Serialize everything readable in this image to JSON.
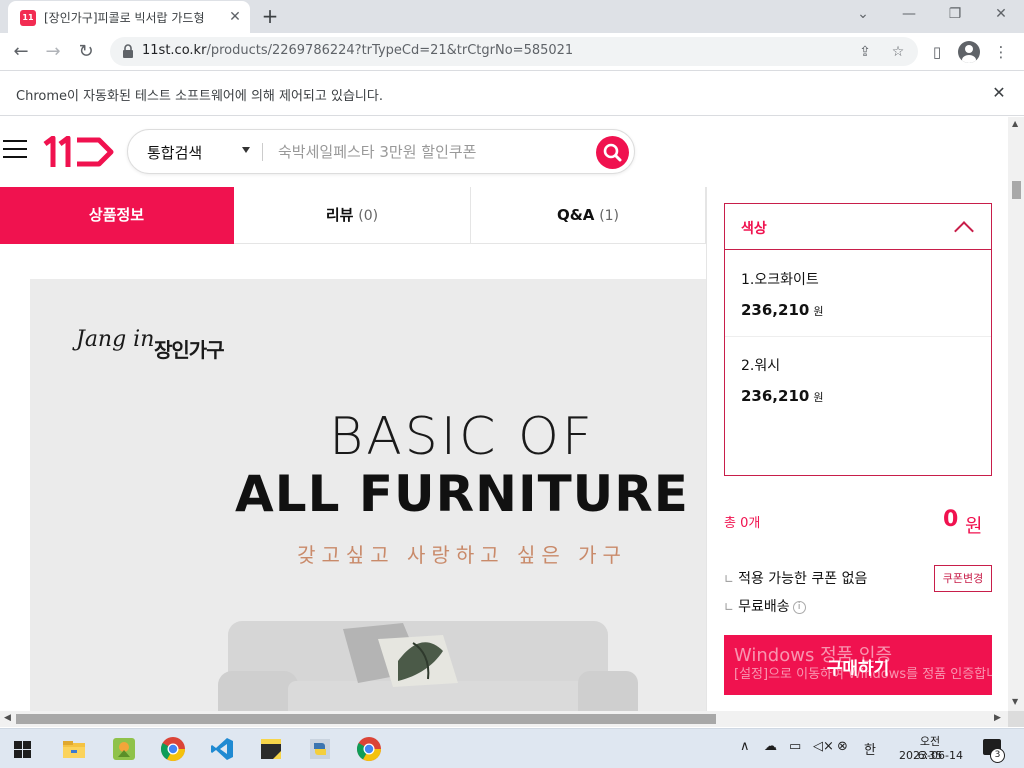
{
  "browser": {
    "tab_title": "[장인가구]피콜로 빅서랍 가드형",
    "tab_favicon_text": "11",
    "new_tab": "+",
    "url_host": "11st.co.kr",
    "url_path": "/products/2269786224?trTypeCd=21&trCtgrNo=585021",
    "infobar_text": "Chrome이 자동화된 테스트 소프트웨어에 의해 제어되고 있습니다."
  },
  "header": {
    "search_category": "통합검색",
    "search_placeholder": "숙박세일페스타 3만원 할인쿠폰"
  },
  "product_tabs": [
    {
      "label": "상품정보",
      "count": ""
    },
    {
      "label": "리뷰",
      "count": "(0)"
    },
    {
      "label": "Q&A",
      "count": "(1)"
    }
  ],
  "visual": {
    "brand_script": "Jang in",
    "brand_name": "장인가구",
    "headline1": "BASIC OF",
    "headline2": "ALL FURNITURE",
    "slogan": "갖고싶고 사랑하고 싶은 가구"
  },
  "options": {
    "header_label": "색상",
    "items": [
      {
        "name": "1.오크화이트",
        "price": "236,210",
        "unit": "원"
      },
      {
        "name": "2.워시",
        "price": "236,210",
        "unit": "원"
      }
    ]
  },
  "summary": {
    "total_label": "총 0개",
    "total_price": "0",
    "total_unit": "원",
    "coupon_text": "적용 가능한 쿠폰 없음",
    "coupon_button": "쿠폰변경",
    "shipping_text": "무료배송",
    "info_glyph": "i",
    "buy_button": "구매하기",
    "watermark_line1": "Windows 정품 인증",
    "watermark_line2": "[설정]으로 이동하여 Windows를 정품 인증합니다."
  },
  "taskbar": {
    "time": "오전 6:35",
    "date": "2023-06-14",
    "ime": "한",
    "notification_count": "3"
  },
  "colors": {
    "accent": "#f0124f",
    "option_border": "#c81e4a"
  }
}
